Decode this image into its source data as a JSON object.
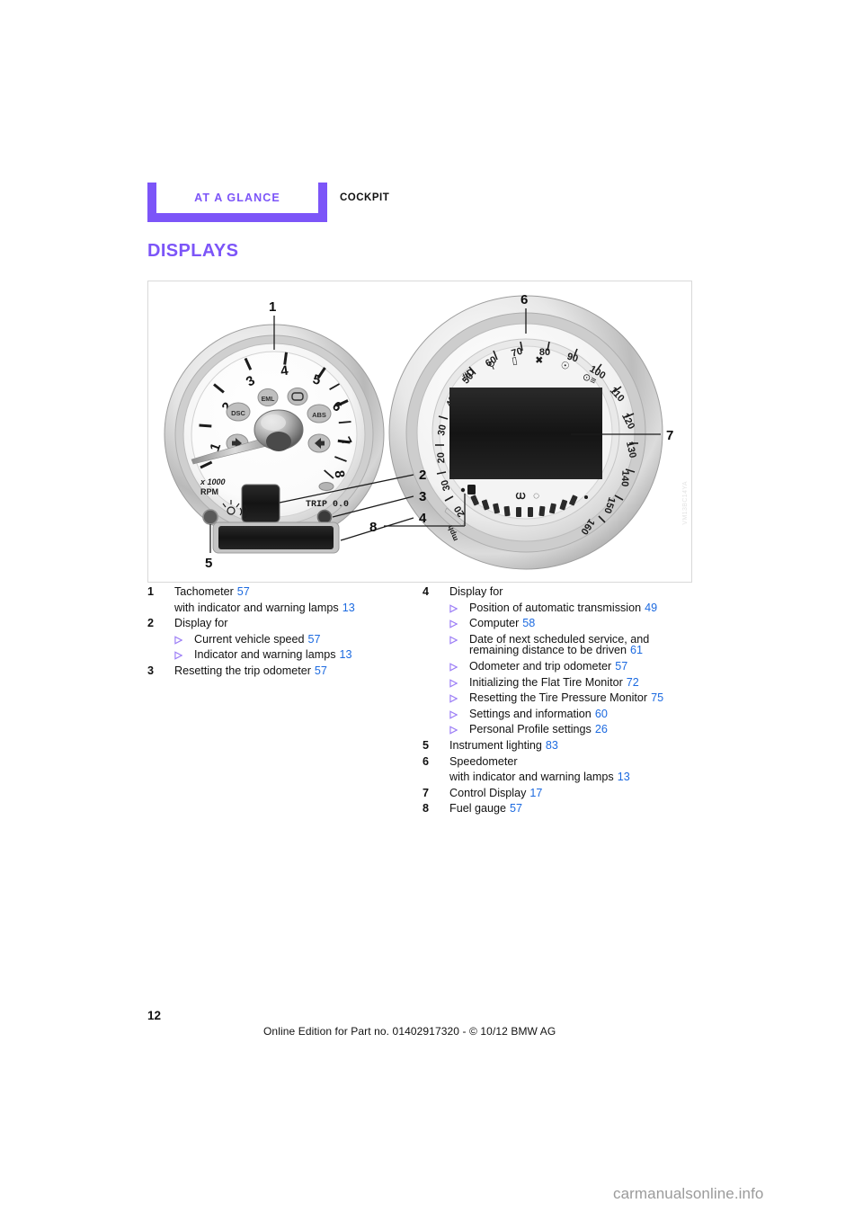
{
  "running_head": {
    "tab_label": "AT A GLANCE",
    "section_label": "COCKPIT"
  },
  "page_title": "DISPLAYS",
  "colors": {
    "accent_purple": "#7c55f8",
    "reference_blue": "#1c6ae0",
    "text_black": "#111111",
    "figure_border": "#d9d9d9",
    "watermark_gray": "#9b9b9b"
  },
  "figure": {
    "name": "instrument-cluster-diagram",
    "watermark": "VM13BC14YA",
    "callouts": [
      "1",
      "2",
      "3",
      "4",
      "5",
      "6",
      "7",
      "8"
    ],
    "tachometer": {
      "scale_numbers": [
        "1",
        "2",
        "3",
        "4",
        "5",
        "6",
        "7",
        "8"
      ],
      "unit_line1": "x 1000",
      "unit_line2": "RPM",
      "trip_label": "TRIP 0.0",
      "indicator_labels": [
        "EML",
        "DSC",
        "ABS"
      ]
    },
    "speedometer": {
      "scale_numbers": [
        "20",
        "30",
        "40",
        "50",
        "60",
        "70",
        "80",
        "90",
        "100",
        "110",
        "120",
        "130",
        "140",
        "150",
        "160"
      ],
      "unit": "mph"
    }
  },
  "legend_left": [
    {
      "number": "1",
      "lines": [
        {
          "text": "Tachometer",
          "ref": "57"
        },
        {
          "text": "with indicator and warning lamps",
          "ref": "13"
        }
      ],
      "subitems": []
    },
    {
      "number": "2",
      "lines": [
        {
          "text": "Display for",
          "ref": ""
        }
      ],
      "subitems": [
        {
          "text": "Current vehicle speed",
          "ref": "57"
        },
        {
          "text": "Indicator and warning lamps",
          "ref": "13"
        }
      ]
    },
    {
      "number": "3",
      "lines": [
        {
          "text": "Resetting the trip odometer",
          "ref": "57"
        }
      ],
      "subitems": []
    }
  ],
  "legend_right": [
    {
      "number": "4",
      "lines": [
        {
          "text": "Display for",
          "ref": ""
        }
      ],
      "subitems": [
        {
          "text": "Position of automatic transmission",
          "ref": "49"
        },
        {
          "text": "Computer",
          "ref": "58"
        },
        {
          "text": "Date of next scheduled service, and remaining distance to be driven",
          "ref": "61"
        },
        {
          "text": "Odometer and trip odometer",
          "ref": "57"
        },
        {
          "text": "Initializing the Flat Tire Monitor",
          "ref": "72"
        },
        {
          "text": "Resetting the Tire Pressure Monitor",
          "ref": "75"
        },
        {
          "text": "Settings and information",
          "ref": "60"
        },
        {
          "text": "Personal Profile settings",
          "ref": "26"
        }
      ]
    },
    {
      "number": "5",
      "lines": [
        {
          "text": "Instrument lighting",
          "ref": "83"
        }
      ],
      "subitems": []
    },
    {
      "number": "6",
      "lines": [
        {
          "text": "Speedometer",
          "ref": ""
        },
        {
          "text": "with indicator and warning lamps",
          "ref": "13"
        }
      ],
      "subitems": []
    },
    {
      "number": "7",
      "lines": [
        {
          "text": "Control Display",
          "ref": "17"
        }
      ],
      "subitems": []
    },
    {
      "number": "8",
      "lines": [
        {
          "text": "Fuel gauge",
          "ref": "57"
        }
      ],
      "subitems": []
    }
  ],
  "footer": {
    "page_number": "12",
    "note": "Online Edition for Part no. 01402917320 - © 10/12 BMW AG",
    "site_watermark": "carmanualsonline.info"
  }
}
